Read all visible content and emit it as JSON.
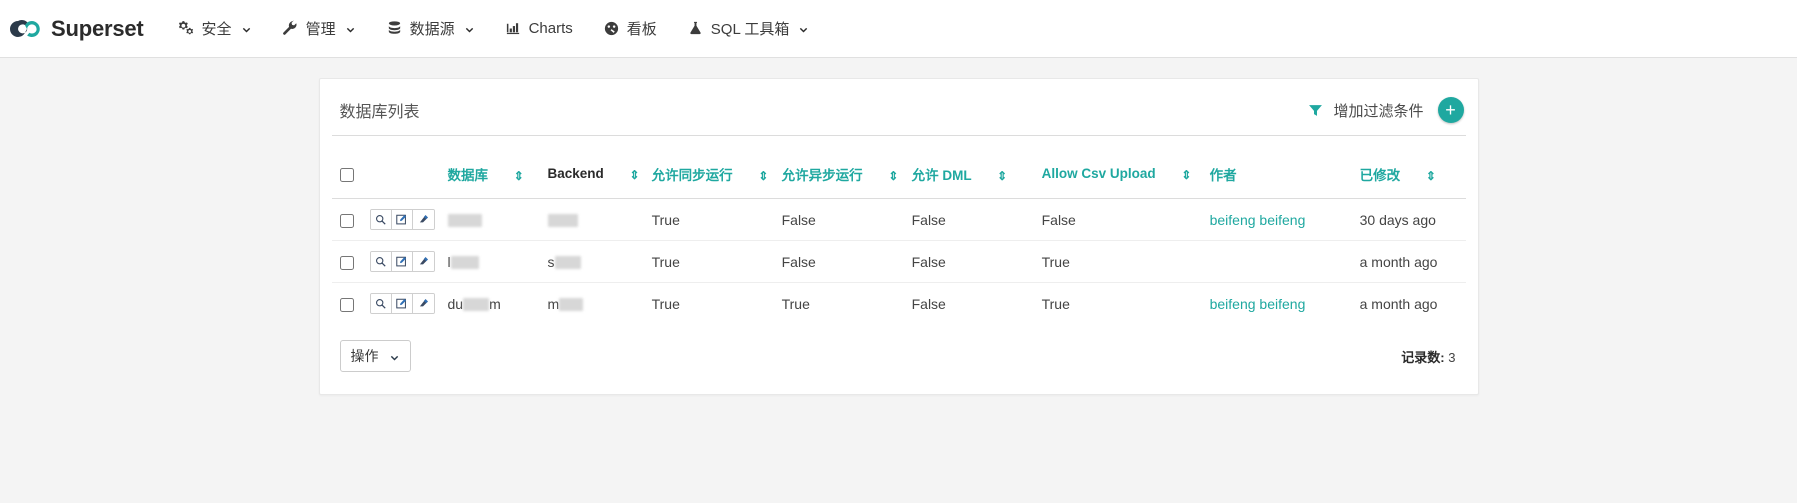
{
  "navbar": {
    "brand": "Superset",
    "brand_logo_icon": "infinity-logo-icon",
    "brand_colors": {
      "dark": "#2b3a4a",
      "teal": "#1fa8a0"
    },
    "items": [
      {
        "label": "安全",
        "icon": "gears-icon",
        "caret": true
      },
      {
        "label": "管理",
        "icon": "wrench-icon",
        "caret": true
      },
      {
        "label": "数据源",
        "icon": "database-icon",
        "caret": true
      },
      {
        "label": "Charts",
        "icon": "bar-chart-icon",
        "caret": false
      },
      {
        "label": "看板",
        "icon": "dashboard-gauge-icon",
        "caret": false
      },
      {
        "label": "SQL 工具箱",
        "icon": "flask-icon",
        "caret": true
      }
    ]
  },
  "panel": {
    "title": "数据库列表",
    "filter_label": "增加过滤条件",
    "filter_icon": "filter-icon",
    "add_label": "+",
    "add_icon": "plus-circle-icon",
    "accent_color": "#1fa8a0"
  },
  "table": {
    "headers": [
      {
        "label": "",
        "sortable": false,
        "kind": "checkbox"
      },
      {
        "label": "",
        "sortable": false,
        "kind": "actions"
      },
      {
        "label": "数据库",
        "sortable": true,
        "style": "link"
      },
      {
        "label": "Backend",
        "sortable": true,
        "style": "plain"
      },
      {
        "label": "允许同步运行",
        "sortable": true,
        "style": "link"
      },
      {
        "label": "允许异步运行",
        "sortable": true,
        "style": "link"
      },
      {
        "label": "允许 DML",
        "sortable": true,
        "style": "link"
      },
      {
        "label": "Allow Csv Upload",
        "sortable": true,
        "style": "link"
      },
      {
        "label": "作者",
        "sortable": false,
        "style": "link"
      },
      {
        "label": "已修改",
        "sortable": true,
        "style": "link"
      }
    ],
    "sort_icon": "sort-updown-icon",
    "row_actions": [
      {
        "icon": "magnifier-icon",
        "name": "view-record-button"
      },
      {
        "icon": "pencil-square-icon",
        "name": "edit-record-button"
      },
      {
        "icon": "eraser-icon",
        "name": "delete-record-button"
      }
    ],
    "rows": [
      {
        "database": "",
        "database_redacted": true,
        "backend": "",
        "backend_redacted": true,
        "allow_run_sync": "True",
        "allow_run_async": "False",
        "allow_dml": "False",
        "allow_csv_upload": "False",
        "owner": "beifeng beifeng",
        "modified": "30 days ago"
      },
      {
        "database": "l",
        "database_redacted": true,
        "backend": "s",
        "backend_redacted": true,
        "allow_run_sync": "True",
        "allow_run_async": "False",
        "allow_dml": "False",
        "allow_csv_upload": "True",
        "owner": "",
        "modified": "a month ago"
      },
      {
        "database": "du",
        "database_suffix": "m",
        "database_redacted": true,
        "backend": "m",
        "backend_redacted": true,
        "allow_run_sync": "True",
        "allow_run_async": "True",
        "allow_dml": "False",
        "allow_csv_upload": "True",
        "owner": "beifeng beifeng",
        "modified": "a month ago"
      }
    ]
  },
  "footer": {
    "bulk_action_label": "操作",
    "bulk_action_caret_icon": "chevron-down-icon",
    "record_count_label": "记录数:",
    "record_count_value": "3"
  }
}
